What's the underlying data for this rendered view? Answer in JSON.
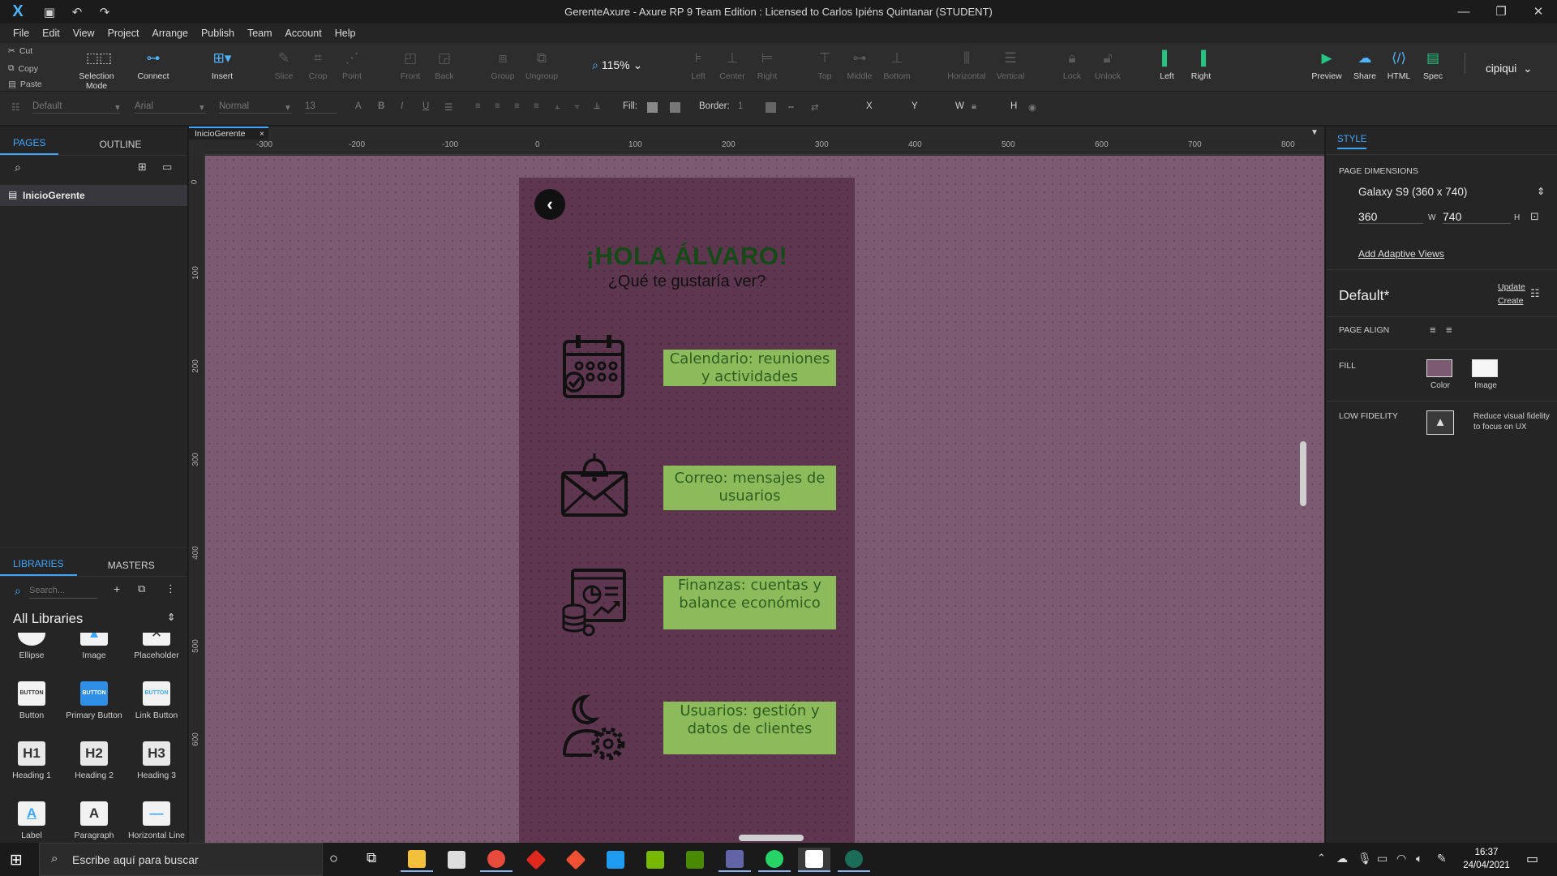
{
  "window": {
    "title": "GerenteAxure - Axure RP 9 Team Edition : Licensed to Carlos Ipiéns Quintanar (STUDENT)",
    "minimize": "—",
    "restore": "❐",
    "close": "✕"
  },
  "menu": [
    "File",
    "Edit",
    "View",
    "Project",
    "Arrange",
    "Publish",
    "Team",
    "Account",
    "Help"
  ],
  "clipboard": {
    "cut": "Cut",
    "copy": "Copy",
    "paste": "Paste"
  },
  "toolbar": {
    "selection_mode": "Selection Mode",
    "connect": "Connect",
    "insert": "Insert",
    "slice": "Slice",
    "crop": "Crop",
    "point": "Point",
    "front": "Front",
    "back": "Back",
    "group": "Group",
    "ungroup": "Ungroup",
    "zoom": "115%",
    "align_left": "Left",
    "align_center": "Center",
    "align_right": "Right",
    "align_top": "Top",
    "align_middle": "Middle",
    "align_bottom": "Bottom",
    "dist_horizontal": "Horizontal",
    "dist_vertical": "Vertical",
    "lock": "Lock",
    "unlock": "Unlock",
    "left": "Left",
    "right": "Right",
    "preview": "Preview",
    "share": "Share",
    "html": "HTML",
    "spec": "Spec",
    "user": "cipiqui"
  },
  "format": {
    "style": "Default",
    "font": "Arial",
    "weight": "Normal",
    "size": "13",
    "fill_label": "Fill:",
    "border_label": "Border:",
    "border_value": "1",
    "x": "X",
    "y": "Y",
    "w": "W",
    "h": "H"
  },
  "left_panel": {
    "tab_pages": "PAGES",
    "tab_outline": "OUTLINE",
    "page": "InicioGerente",
    "tab_libraries": "LIBRARIES",
    "tab_masters": "MASTERS",
    "search_placeholder": "Search...",
    "library_select": "All Libraries",
    "widgets": [
      {
        "label": "Ellipse",
        "glyph": "○"
      },
      {
        "label": "Image",
        "glyph": "▲"
      },
      {
        "label": "Placeholder",
        "glyph": "✕"
      },
      {
        "label": "Button",
        "glyph": "BUTTON"
      },
      {
        "label": "Primary Button",
        "glyph": "BUTTON"
      },
      {
        "label": "Link Button",
        "glyph": "BUTTON"
      },
      {
        "label": "Heading 1",
        "glyph": "H1"
      },
      {
        "label": "Heading 2",
        "glyph": "H2"
      },
      {
        "label": "Heading 3",
        "glyph": "H3"
      },
      {
        "label": "Label",
        "glyph": "A"
      },
      {
        "label": "Paragraph",
        "glyph": "A"
      },
      {
        "label": "Horizontal Line",
        "glyph": "—"
      }
    ]
  },
  "document": {
    "tab": "InicioGerente",
    "ruler_h": [
      "-300",
      "-200",
      "-100",
      "0",
      "100",
      "200",
      "300",
      "400",
      "500",
      "600",
      "700",
      "800"
    ],
    "ruler_v": [
      "0",
      "100",
      "200",
      "300",
      "400",
      "500",
      "600"
    ]
  },
  "prototype": {
    "back_glyph": "‹",
    "greeting": "¡HOLA ÁLVARO!",
    "question": "¿Qué te gustaría ver?",
    "cards": [
      {
        "text": "Calendario: reuniones y actividades",
        "icon": "calendar-icon"
      },
      {
        "text": "Correo: mensajes de usuarios",
        "icon": "mail-icon"
      },
      {
        "text": "Finanzas: cuentas y balance económico",
        "icon": "finance-icon"
      },
      {
        "text": "Usuarios: gestión y datos de clientes",
        "icon": "users-gear-icon"
      }
    ],
    "colors": {
      "background": "#5e3650",
      "card": "#8dbb5c",
      "card_text": "#2f5e21",
      "title": "#154a16"
    }
  },
  "right_panel": {
    "tab": "STYLE",
    "page_dimensions_label": "PAGE DIMENSIONS",
    "device": "Galaxy S9  (360 x 740)",
    "width": "360",
    "w_label": "W",
    "height": "740",
    "h_label": "H",
    "adaptive": "Add Adaptive Views",
    "style_name": "Default*",
    "update": "Update",
    "create": "Create",
    "page_align": "PAGE ALIGN",
    "fill": "FILL",
    "fill_color": "Color",
    "fill_image": "Image",
    "low_fidelity": "LOW FIDELITY",
    "low_fidelity_desc": "Reduce visual fidelity to focus on UX"
  },
  "taskbar": {
    "search_placeholder": "Escribe aquí para buscar",
    "time": "16:37",
    "date": "24/04/2021"
  }
}
